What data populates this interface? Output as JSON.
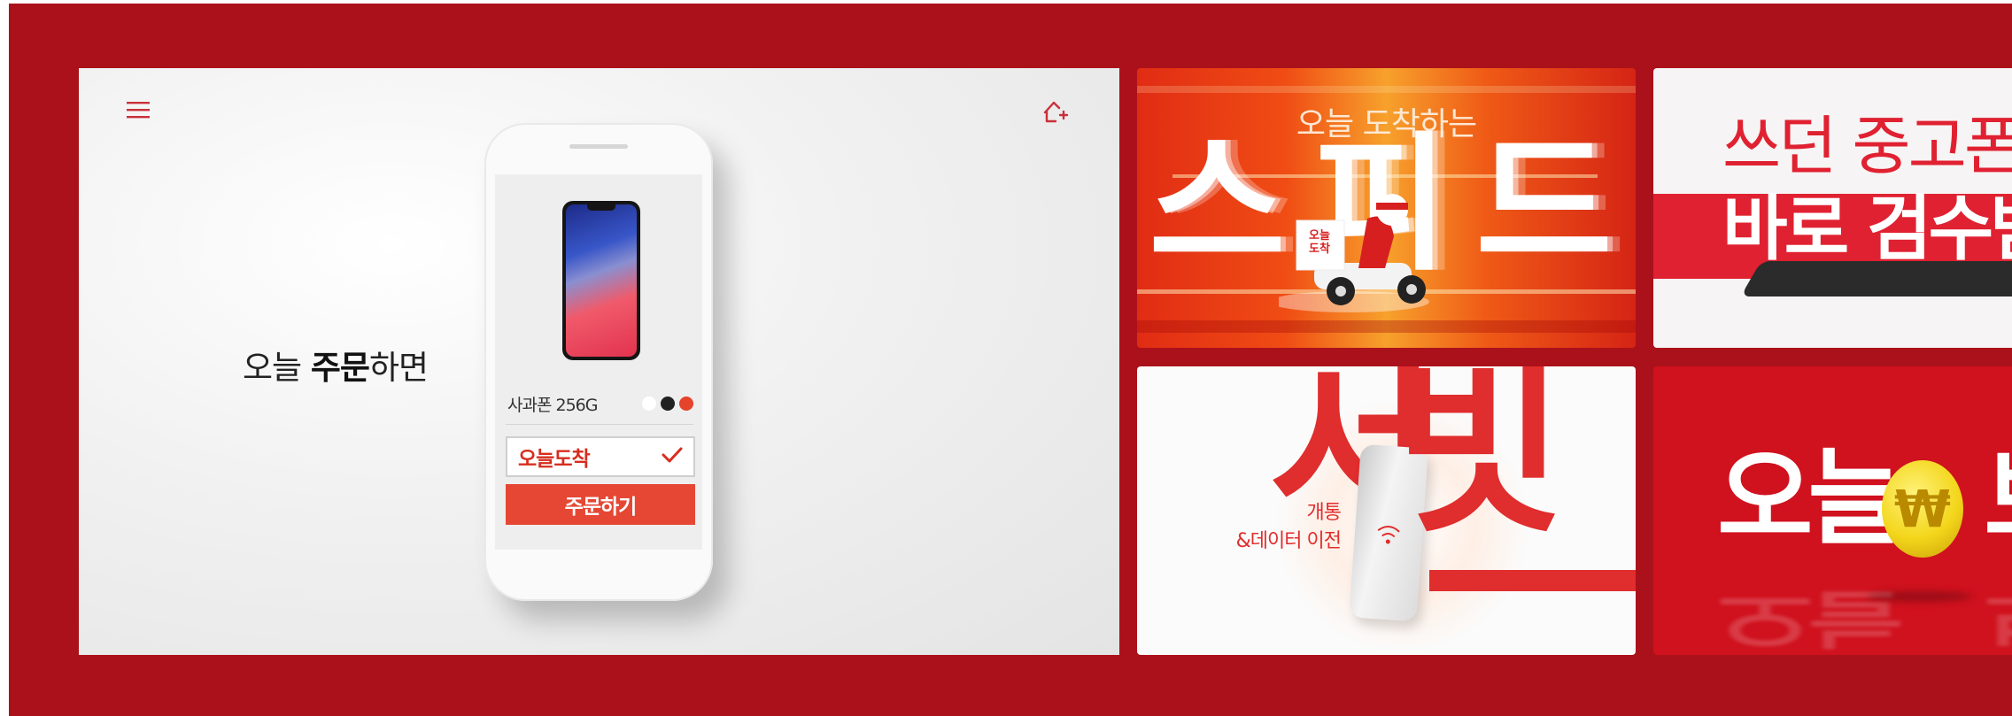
{
  "main": {
    "headline_pre": "오늘 ",
    "headline_bold": "주문",
    "headline_post": "하면",
    "menu_icon": "hamburger-menu-icon",
    "home_icon": "home-add-icon"
  },
  "phone_mockup": {
    "product_name": "사과폰 256G",
    "swatch_colors": [
      "#ffffff",
      "#222222",
      "#e5432b"
    ],
    "delivery_option": "오늘도착",
    "delivery_checked": true,
    "order_button": "주문하기"
  },
  "promos": {
    "speed": {
      "subtitle": "오늘 도착하는",
      "title": "스피드",
      "badge": "오늘 도착"
    },
    "used_phone": {
      "line1": "쓰던 중고폰",
      "line2": "바로 검수받"
    },
    "service": {
      "big_left": "서",
      "big_right": "빗",
      "line1": "개통",
      "line2": "&데이터 이전"
    },
    "refund": {
      "text_left": "오늘",
      "coin_symbol": "₩",
      "text_right": "보"
    }
  },
  "colors": {
    "background": "#ab111b",
    "accent": "#e54734",
    "brand_red": "#e02131"
  }
}
